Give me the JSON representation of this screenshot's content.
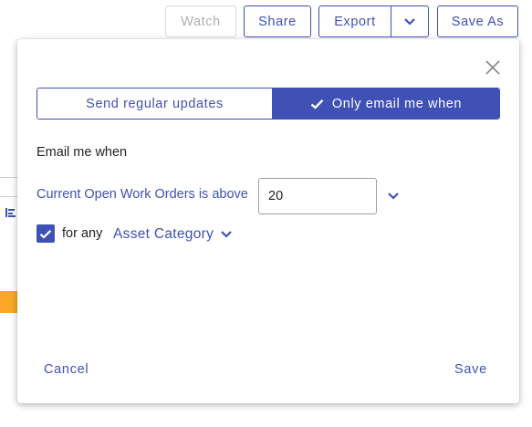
{
  "toolbar": {
    "watch_label": "Watch",
    "share_label": "Share",
    "export_label": "Export",
    "save_as_label": "Save As"
  },
  "dialog": {
    "mode_toggle": {
      "regular_label": "Send regular updates",
      "conditional_label": "Only email me when",
      "selected": "conditional"
    },
    "heading": "Email me when",
    "condition": {
      "label": "Current Open Work Orders is above",
      "value": "20"
    },
    "filter": {
      "checked": true,
      "prefix": "for any",
      "category": "Asset Category"
    },
    "cancel_label": "Cancel",
    "save_label": "Save"
  },
  "icons": {
    "close": "close-icon",
    "check": "check-icon",
    "chevron": "chevron-down-icon"
  },
  "colors": {
    "accent": "#3f51b5",
    "orange": "#f9a825"
  }
}
